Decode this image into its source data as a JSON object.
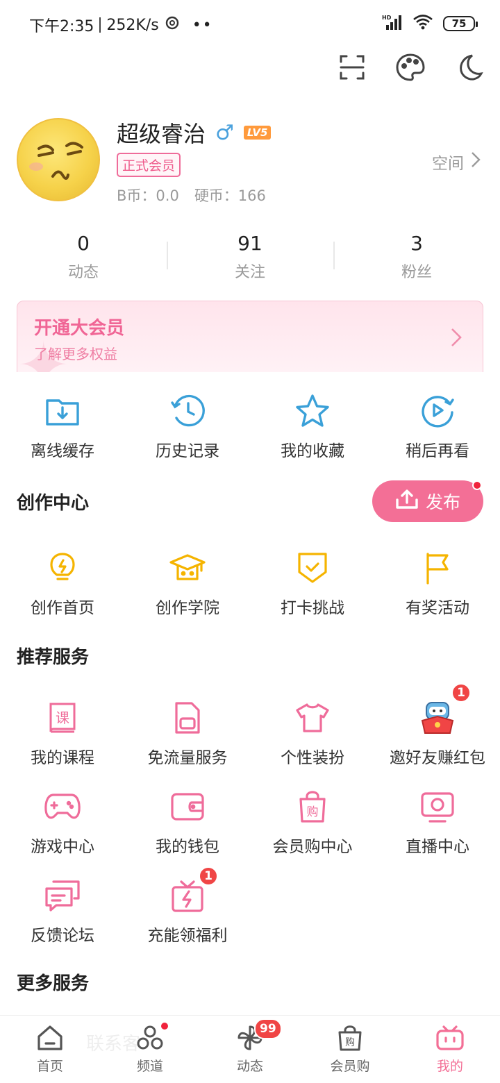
{
  "status_bar": {
    "time": "下午2:35",
    "speed": "252K/s",
    "dots": "••",
    "network": "HD",
    "battery": "75"
  },
  "profile": {
    "username": "超级睿治",
    "gender_symbol": "♂",
    "level": "LV5",
    "vip_tag": "正式会员",
    "bcoin": "B币：0.0",
    "coin": "硬币：166",
    "space_label": "空间"
  },
  "stats": [
    {
      "num": "0",
      "label": "动态"
    },
    {
      "num": "91",
      "label": "关注"
    },
    {
      "num": "3",
      "label": "粉丝"
    }
  ],
  "vip_banner": {
    "title": "开通大会员",
    "subtitle": "了解更多权益"
  },
  "quick_actions": [
    {
      "label": "离线缓存",
      "icon": "download-folder-icon"
    },
    {
      "label": "历史记录",
      "icon": "history-clock-icon"
    },
    {
      "label": "我的收藏",
      "icon": "star-icon"
    },
    {
      "label": "稍后再看",
      "icon": "watch-later-icon"
    }
  ],
  "creation": {
    "title": "创作中心",
    "publish_label": "发布",
    "items": [
      {
        "label": "创作首页",
        "icon": "bulb-icon"
      },
      {
        "label": "创作学院",
        "icon": "grad-cap-icon"
      },
      {
        "label": "打卡挑战",
        "icon": "check-shield-icon"
      },
      {
        "label": "有奖活动",
        "icon": "flag-icon"
      }
    ]
  },
  "recommended": {
    "title": "推荐服务",
    "items": [
      {
        "label": "我的课程",
        "icon": "course-book-icon",
        "glyph": "课"
      },
      {
        "label": "免流量服务",
        "icon": "sim-card-icon"
      },
      {
        "label": "个性装扮",
        "icon": "tshirt-icon"
      },
      {
        "label": "邀好友赚红包",
        "icon": "mascot-redpacket-icon",
        "badge": "1"
      },
      {
        "label": "游戏中心",
        "icon": "gamepad-icon"
      },
      {
        "label": "我的钱包",
        "icon": "wallet-icon"
      },
      {
        "label": "会员购中心",
        "icon": "shopping-bag-icon",
        "glyph": "购"
      },
      {
        "label": "直播中心",
        "icon": "live-tv-icon"
      },
      {
        "label": "反馈论坛",
        "icon": "chat-bubbles-icon"
      },
      {
        "label": "充能领福利",
        "icon": "gift-bolt-icon",
        "badge": "1"
      }
    ]
  },
  "more_services": {
    "title": "更多服务",
    "peek_text": "联系客"
  },
  "tabbar": [
    {
      "label": "首页",
      "icon": "home-icon"
    },
    {
      "label": "频道",
      "icon": "channel-icon"
    },
    {
      "label": "动态",
      "icon": "pinwheel-icon",
      "badge": "99"
    },
    {
      "label": "会员购",
      "icon": "bag-icon",
      "glyph": "购"
    },
    {
      "label": "我的",
      "icon": "tv-mascot-icon"
    }
  ],
  "colors": {
    "accent": "#f36f96",
    "pink_icon": "#ef6c9a",
    "yellow_icon": "#f5b400",
    "blue_icon": "#3aa0d8"
  }
}
